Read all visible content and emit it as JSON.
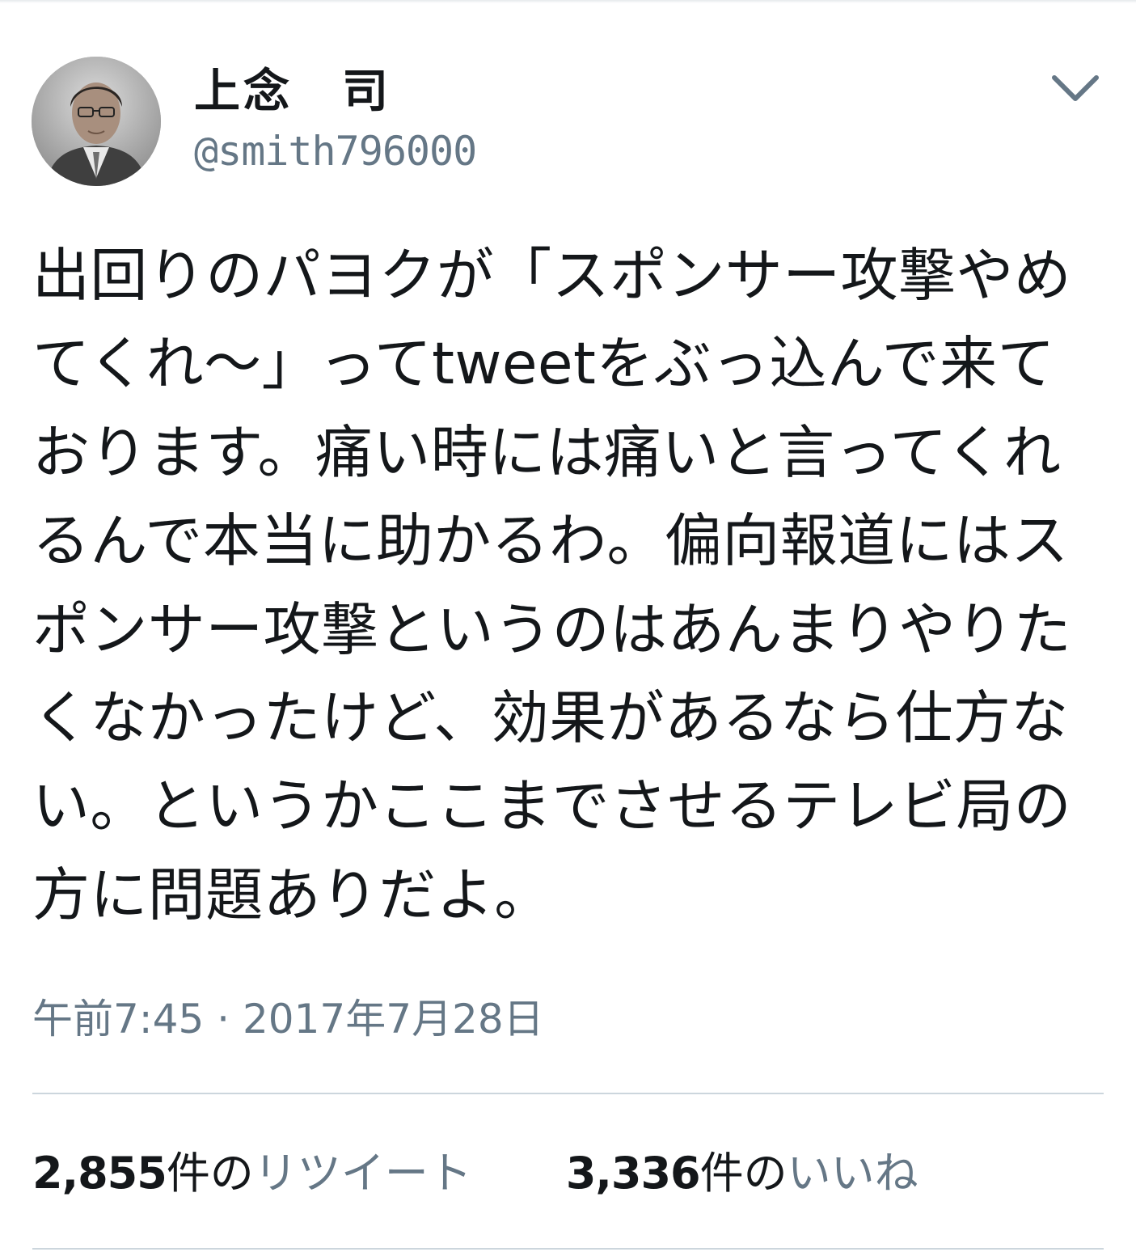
{
  "tweet": {
    "display_name": "上念　司",
    "handle": "@smith796000",
    "text_lines": [
      "出回りのパヨクが「スポンサー攻撃やめ",
      "てくれ～」ってtweetをぶっ込んで来て",
      "おります。痛い時には痛いと言ってくれ",
      "るんで本当に助かるわ。偏向報道にはス",
      "ポンサー攻撃というのはあんまりやりた",
      "くなかったけど、効果があるなら仕方な",
      "い。というかここまでさせるテレビ局の",
      "方に問題ありだよ。"
    ],
    "timestamp": "午前7:45 · 2017年7月28日"
  },
  "stats": {
    "retweets": {
      "count": "2,855",
      "unit": "件の",
      "label": "リツイート"
    },
    "likes": {
      "count": "3,336",
      "unit": "件の",
      "label": "いいね"
    }
  },
  "icons": {
    "menu": "chevron-down-icon",
    "avatar": "profile-photo"
  },
  "colors": {
    "primary_text": "#14171a",
    "secondary_text": "#657786",
    "divider": "#ccd6dd",
    "background": "#ffffff"
  }
}
